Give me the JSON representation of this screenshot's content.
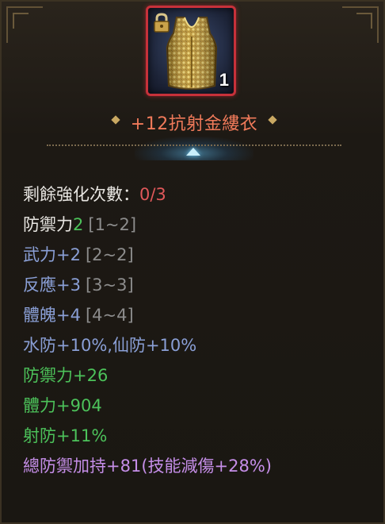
{
  "item": {
    "name": "+12抗射金縷衣",
    "stack_count": "1",
    "locked": true,
    "frame_color": "#c7313a",
    "icon": "golden-vest-icon"
  },
  "stats": {
    "remaining_enhance_label": "剩餘強化次數：",
    "remaining_enhance_value": "0/3",
    "defense": {
      "label": "防禦力",
      "value": "2",
      "range": "[1~2]"
    },
    "martial": {
      "label": "武力+2",
      "range": "[2~2]"
    },
    "reflex": {
      "label": "反應+3",
      "range": "[3~3]"
    },
    "physique": {
      "label": "體魄+4",
      "range": "[4~4]"
    },
    "resist_line": "水防+10%,仙防+10%",
    "bonus_defense": "防禦力+26",
    "bonus_stamina": "體力+904",
    "bonus_shot_resist": "射防+11%",
    "total_defense_bonus": "總防禦加持+81(技能減傷+28%)"
  },
  "colors": {
    "title": "#f07a5a",
    "base_stat": "#8a9fd6",
    "bonus_stat": "#4cc25a",
    "special": "#c58ee8",
    "warning": "#e0585a"
  }
}
